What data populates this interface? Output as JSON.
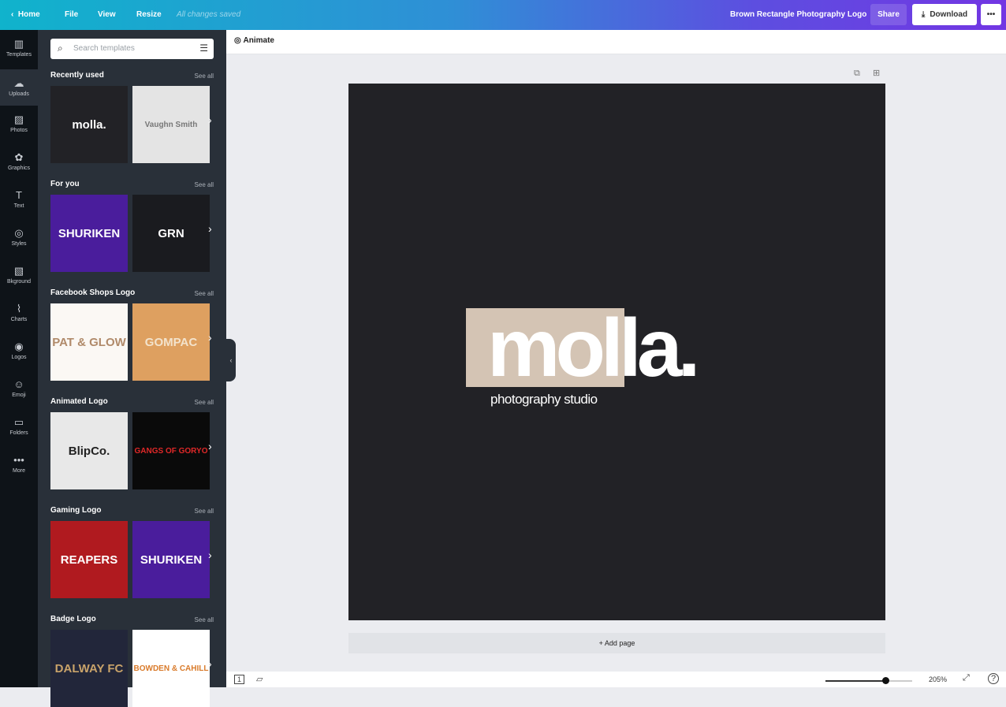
{
  "topbar": {
    "home": "Home",
    "file": "File",
    "view": "View",
    "resize": "Resize",
    "status": "All changes saved",
    "doc_title": "Brown Rectangle Photography Logo",
    "share": "Share",
    "download": "Download",
    "more": "•••"
  },
  "rail": [
    {
      "label": "Templates",
      "icon": "▥"
    },
    {
      "label": "Uploads",
      "icon": "☁"
    },
    {
      "label": "Photos",
      "icon": "▨"
    },
    {
      "label": "Graphics",
      "icon": "✿"
    },
    {
      "label": "Text",
      "icon": "T"
    },
    {
      "label": "Styles",
      "icon": "◎"
    },
    {
      "label": "Bkground",
      "icon": "▧"
    },
    {
      "label": "Charts",
      "icon": "⌇"
    },
    {
      "label": "Logos",
      "icon": "◉"
    },
    {
      "label": "Emoji",
      "icon": "☺"
    },
    {
      "label": "Folders",
      "icon": "▭"
    },
    {
      "label": "More",
      "icon": "•••"
    }
  ],
  "panel": {
    "search_placeholder": "Search templates",
    "see_all": "See all",
    "sections": [
      {
        "title": "Recently used",
        "items": [
          {
            "text": "molla.",
            "bg": "#222226",
            "fg": "#fff"
          },
          {
            "text": "Vaughn Smith",
            "bg": "#e4e4e4",
            "fg": "#777"
          }
        ]
      },
      {
        "title": "For you",
        "items": [
          {
            "text": "SHURIKEN",
            "bg": "#4a1d9c",
            "fg": "#fff"
          },
          {
            "text": "GRN",
            "bg": "#1a1b1f",
            "fg": "#fff"
          }
        ]
      },
      {
        "title": "Facebook Shops Logo",
        "items": [
          {
            "text": "PAT & GLOW",
            "bg": "#fbf8f4",
            "fg": "#b08a6a"
          },
          {
            "text": "GOMPAC",
            "bg": "#dea060",
            "fg": "#f3e3cc"
          }
        ]
      },
      {
        "title": "Animated Logo",
        "items": [
          {
            "text": "BlipCo.",
            "bg": "#e8e8e8",
            "fg": "#222"
          },
          {
            "text": "GANGS OF GORYO",
            "bg": "#0a0a0a",
            "fg": "#e02828"
          }
        ]
      },
      {
        "title": "Gaming Logo",
        "items": [
          {
            "text": "REAPERS",
            "bg": "#b01a1f",
            "fg": "#fff"
          },
          {
            "text": "SHURIKEN",
            "bg": "#4a1d9c",
            "fg": "#fff"
          }
        ]
      },
      {
        "title": "Badge Logo",
        "items": [
          {
            "text": "DALWAY FC",
            "bg": "#22263a",
            "fg": "#c9a36a"
          },
          {
            "text": "BOWDEN & CAHILL",
            "bg": "#fff",
            "fg": "#d97a2a"
          }
        ]
      }
    ]
  },
  "toolbar": {
    "animate": "Animate"
  },
  "design": {
    "logo_text": "molla.",
    "tagline": "photography studio",
    "accent": "#d4c4b4",
    "background": "#222226"
  },
  "add_page": "+ Add page",
  "footer": {
    "zoom": "205%",
    "zoom_percent": 205,
    "page_number": "1"
  }
}
